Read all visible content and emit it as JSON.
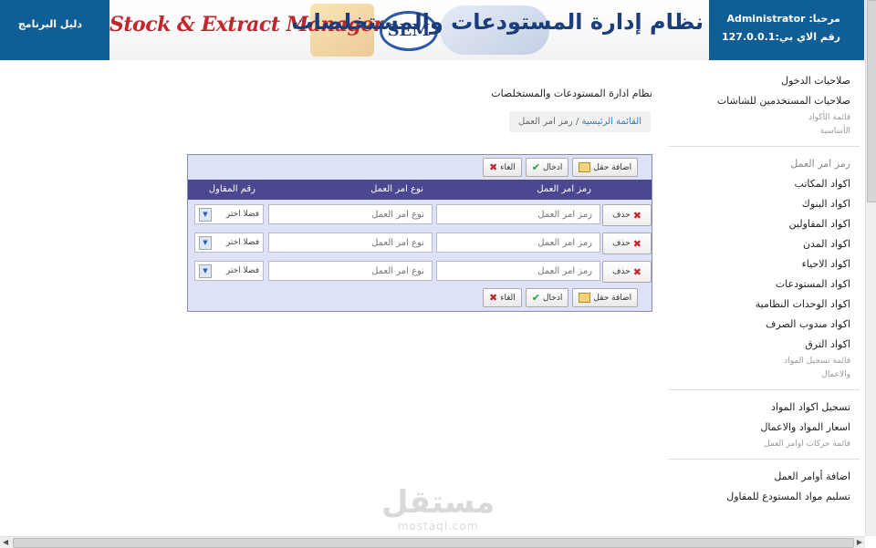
{
  "header": {
    "program_guide": "دليل البرنامج",
    "welcome": "مرحبا: Administrator",
    "ip": "رقم الاي بي:127.0.0.1",
    "banner_en": "Stock & Extract Management",
    "banner_sem": "SEM",
    "banner_ar": "نظام إدارة المستودعات والمستخلصات"
  },
  "main": {
    "title": "نظام ادارة المستودعات والمستخلصات",
    "breadcrumb_home": "القائمة الرئيسية",
    "breadcrumb_sep": "/",
    "breadcrumb_current": "رمز امر العمل"
  },
  "toolbar": {
    "add": "اضافة حقل",
    "save": "ادخال",
    "cancel": "الغاء"
  },
  "table": {
    "headers": [
      "رمز امر العمل",
      "نوع امر العمل",
      "رقم المقاول"
    ],
    "delete_label": "حذف",
    "rows": [
      {
        "code_placeholder": "رمز امر العمل",
        "type_placeholder": "نوع امر العمل",
        "contractor": "فضلا اختر"
      },
      {
        "code_placeholder": "رمز امر العمل",
        "type_placeholder": "نوع امر العمل",
        "contractor": "فضلا اختر"
      },
      {
        "code_placeholder": "رمز امر العمل",
        "type_placeholder": "نوع امر العمل",
        "contractor": "فضلا اختر"
      }
    ]
  },
  "sidebar": {
    "group1": [
      "صلاحيات الدخول",
      "صلاحيات المستخدمين للشاشات"
    ],
    "group1_muted": [
      "قائمة الأكواد",
      "الأساسية"
    ],
    "group2_current": "رمز امر العمل",
    "group2": [
      "اكواد المكاتب",
      "اكواد البنوك",
      "اكواد المقاولين",
      "اكواد المدن",
      "اكواد الاحياء",
      "اكواد المستودعات",
      "اكواد الوحدات النظامية",
      "اكواد مندوب الصرف",
      "اكواد الترق"
    ],
    "group2_muted": [
      "قائمة تسجيل المواد",
      "والاعمال"
    ],
    "group3": [
      "تسجيل اكواد المواد",
      "اسعار المواد والاعمال"
    ],
    "group3_muted": [
      "قائمة حركات اوامر العمل"
    ],
    "group4": [
      "اضافة أوامر العمل",
      "تسليم مواد المستودع للمقاول"
    ]
  },
  "watermark": {
    "ar": "مستقل",
    "en": "mostaql.com"
  },
  "colors": {
    "header_blue": "#0f5f96",
    "table_header": "#4b4790",
    "panel_bg": "#dde2f8"
  }
}
